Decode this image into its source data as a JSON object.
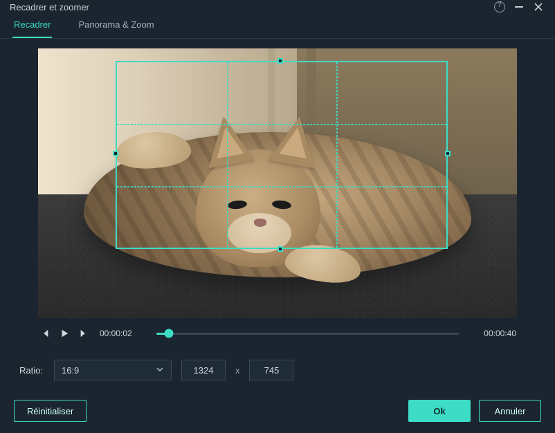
{
  "window": {
    "title": "Recadrer et zoomer"
  },
  "tabs": {
    "crop": "Recadrer",
    "panzoom": "Panorama & Zoom"
  },
  "playback": {
    "current": "00:00:02",
    "total": "00:00:40",
    "progress_pct": 4
  },
  "ratio": {
    "label": "Ratio:",
    "selected": "16:9",
    "width": "1324",
    "height": "745",
    "sep": "x"
  },
  "buttons": {
    "reset": "Réinitialiser",
    "ok": "Ok",
    "cancel": "Annuler"
  },
  "icons": {
    "help": "help",
    "minimize": "minimize",
    "close": "close",
    "prev_frame": "prev-frame",
    "play": "play",
    "next_frame": "next-frame",
    "chevron_down": "chevron-down"
  }
}
